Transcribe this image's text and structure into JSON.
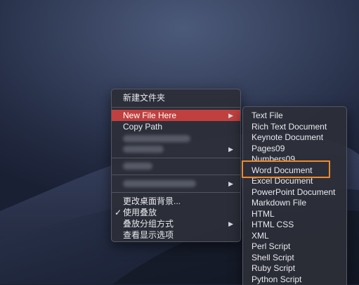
{
  "main_menu": {
    "new_folder": "新建文件夹",
    "new_file_here": "New File Here",
    "copy_path": "Copy Path",
    "change_background": "更改桌面背景...",
    "use_stacks": "使用叠放",
    "group_stacks_by": "叠放分组方式",
    "show_view_options": "查看显示选项",
    "checkmark": "✓"
  },
  "submenu": {
    "items": [
      "Text File",
      "Rich Text Document",
      "Keynote Document",
      "Pages09",
      "Numbers09",
      "Word Document",
      "Excel Document",
      "PowerPoint Document",
      "Markdown File",
      "HTML",
      "HTML CSS",
      "XML",
      "Perl Script",
      "Shell Script",
      "Ruby Script",
      "Python Script"
    ],
    "highlighted_item": "Word Document"
  },
  "colors": {
    "highlight": "#c0403f",
    "annotation_box": "#f08a2a"
  }
}
